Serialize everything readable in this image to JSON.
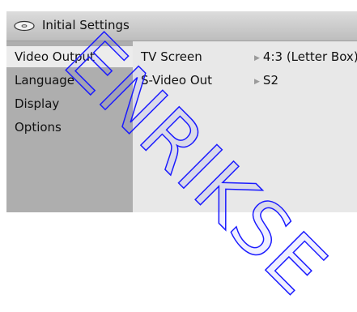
{
  "header": {
    "title": "Initial Settings",
    "icon": "disc-icon"
  },
  "sidebar": {
    "items": [
      {
        "label": "Video Output",
        "selected": true
      },
      {
        "label": "Language",
        "selected": false
      },
      {
        "label": "Display",
        "selected": false
      },
      {
        "label": "Options",
        "selected": false
      }
    ]
  },
  "settings": {
    "rows": [
      {
        "label": "TV Screen",
        "value": "4:3 (Letter Box)"
      },
      {
        "label": "S-Video Out",
        "value": "S2"
      }
    ]
  },
  "watermark": {
    "text": "ENRIKSE"
  },
  "colors": {
    "selected_bg": "#ececec",
    "sidebar_bg": "#aeaeae",
    "content_bg": "#e8e8e8",
    "watermark": "#1a1aff"
  }
}
